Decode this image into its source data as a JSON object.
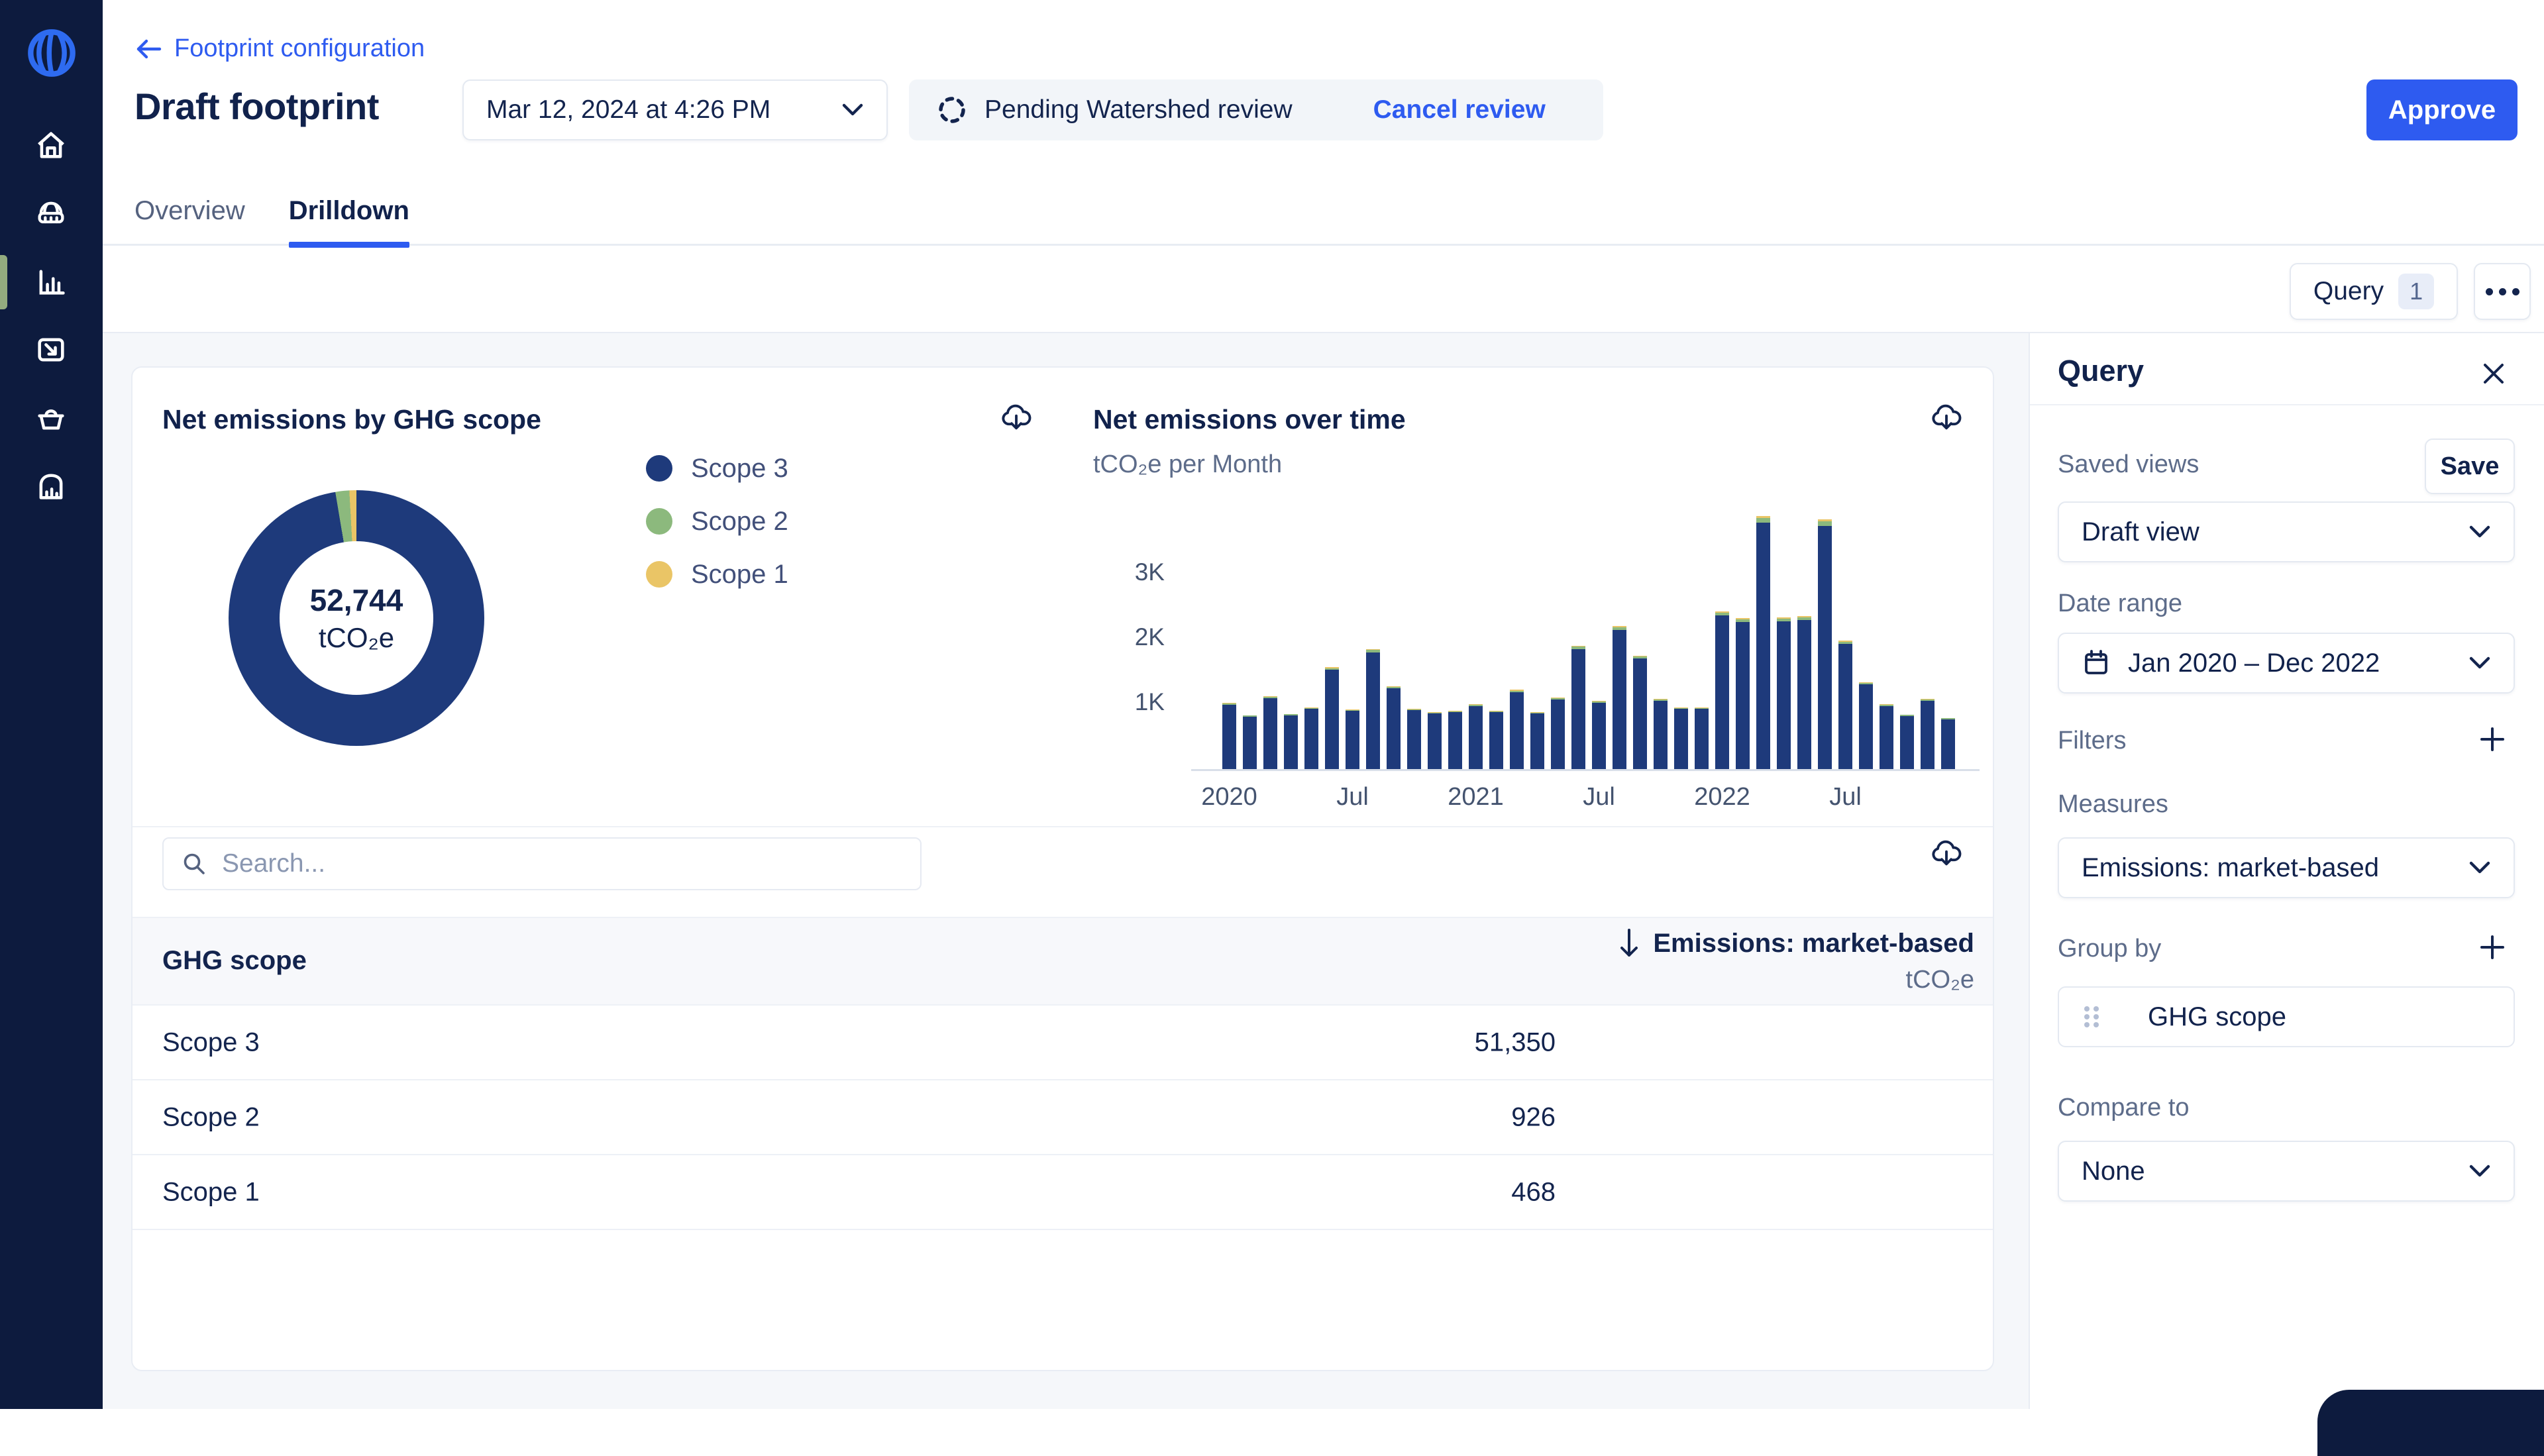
{
  "colors": {
    "accent": "#2e5bf0",
    "sidebar_bg": "#0d1b3e",
    "active_indicator": "#93ac7f",
    "scope3": "#1e3a7b",
    "scope2": "#8cb97d",
    "scope1": "#eac566"
  },
  "sidebar": {
    "logo": "watershed-logo",
    "items": [
      {
        "icon": "home-icon",
        "active": false
      },
      {
        "icon": "measurement-globe-icon",
        "active": false
      },
      {
        "icon": "bar-chart-icon",
        "active": true
      },
      {
        "icon": "export-icon",
        "active": false
      },
      {
        "icon": "basket-icon",
        "active": false
      },
      {
        "icon": "reports-icon",
        "active": false
      }
    ]
  },
  "header": {
    "back_label": "Footprint configuration",
    "title": "Draft footprint",
    "version_value": "Mar 12, 2024 at 4:26 PM",
    "review_status": "Pending Watershed review",
    "cancel_label": "Cancel review",
    "approve_label": "Approve"
  },
  "tabs": {
    "items": [
      {
        "label": "Overview",
        "active": false
      },
      {
        "label": "Drilldown",
        "active": true
      }
    ]
  },
  "toolbar": {
    "query_label": "Query",
    "query_count": "1"
  },
  "search": {
    "placeholder": "Search..."
  },
  "table": {
    "col1": "GHG scope",
    "col2_title": "Emissions: market-based",
    "col2_unit": "tCO₂e",
    "rows": [
      {
        "label": "Scope 3",
        "value": "51,350"
      },
      {
        "label": "Scope 2",
        "value": "926"
      },
      {
        "label": "Scope 1",
        "value": "468"
      }
    ]
  },
  "query_panel": {
    "title": "Query",
    "saved_views_label": "Saved views",
    "save_label": "Save",
    "view_value": "Draft view",
    "date_range_label": "Date range",
    "date_range_value": "Jan 2020 – Dec 2022",
    "filters_label": "Filters",
    "measures_label": "Measures",
    "measures_value": "Emissions: market-based",
    "group_by_label": "Group by",
    "group_by_value": "GHG scope",
    "compare_label": "Compare to",
    "compare_value": "None"
  },
  "chart_data": [
    {
      "type": "pie",
      "title": "Net emissions by GHG scope",
      "center_value": "52,744",
      "center_unit": "tCO₂e",
      "legend_position": "right",
      "segments": [
        {
          "label": "Scope 3",
          "value": 51350,
          "color": "#1e3a7b"
        },
        {
          "label": "Scope 2",
          "value": 926,
          "color": "#8cb97d"
        },
        {
          "label": "Scope 1",
          "value": 468,
          "color": "#eac566"
        }
      ]
    },
    {
      "type": "bar",
      "stacked": true,
      "title": "Net emissions over time",
      "subtitle": "tCO₂e per Month",
      "ylabel": "tCO₂e",
      "ylim": [
        0,
        4000
      ],
      "grid": false,
      "y_ticks": [
        "1K",
        "2K",
        "3K"
      ],
      "x": [
        "Jan 2020",
        "Feb 2020",
        "Mar 2020",
        "Apr 2020",
        "May 2020",
        "Jun 2020",
        "Jul 2020",
        "Aug 2020",
        "Sep 2020",
        "Oct 2020",
        "Nov 2020",
        "Dec 2020",
        "Jan 2021",
        "Feb 2021",
        "Mar 2021",
        "Apr 2021",
        "May 2021",
        "Jun 2021",
        "Jul 2021",
        "Aug 2021",
        "Sep 2021",
        "Oct 2021",
        "Nov 2021",
        "Dec 2021",
        "Jan 2022",
        "Feb 2022",
        "Mar 2022",
        "Apr 2022",
        "May 2022",
        "Jun 2022",
        "Jul 2022",
        "Aug 2022",
        "Sep 2022",
        "Oct 2022",
        "Nov 2022",
        "Dec 2022"
      ],
      "x_tick_labels": [
        {
          "index": 0,
          "label": "2020"
        },
        {
          "index": 6,
          "label": "Jul"
        },
        {
          "index": 12,
          "label": "2021"
        },
        {
          "index": 18,
          "label": "Jul"
        },
        {
          "index": 24,
          "label": "2022"
        },
        {
          "index": 30,
          "label": "Jul"
        }
      ],
      "totals": [
        1020,
        830,
        1120,
        850,
        950,
        1570,
        920,
        1850,
        1280,
        930,
        880,
        900,
        1000,
        900,
        1220,
        880,
        1100,
        1900,
        1050,
        2200,
        1750,
        1080,
        950,
        950,
        2430,
        2330,
        3900,
        2340,
        2360,
        3850,
        1980,
        1340,
        1000,
        840,
        1080,
        790
      ],
      "series": [
        {
          "name": "Scope 3",
          "fraction": 0.973,
          "color": "#1e3a7b"
        },
        {
          "name": "Scope 2",
          "fraction": 0.018,
          "color": "#8cb97d"
        },
        {
          "name": "Scope 1",
          "fraction": 0.009,
          "color": "#eac566"
        }
      ]
    }
  ]
}
